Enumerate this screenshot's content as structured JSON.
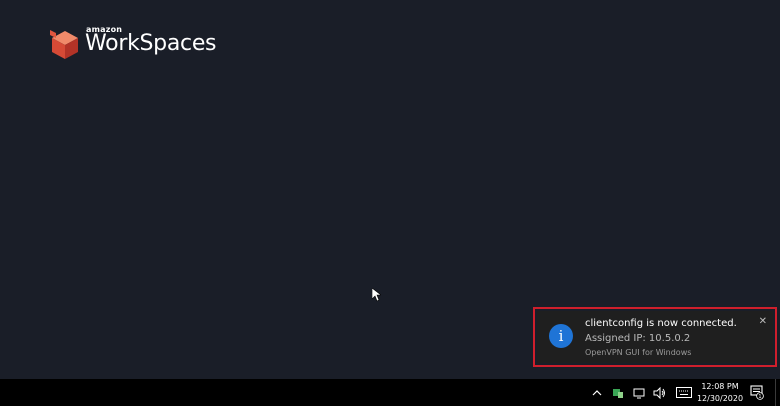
{
  "logo": {
    "small_text": "amazon",
    "main_text": "WorkSpaces",
    "icon": "cube-logo"
  },
  "notification": {
    "icon": "info-icon",
    "icon_glyph": "i",
    "title": "clientconfig is now connected.",
    "body": "Assigned IP: 10.5.0.2",
    "source": "OpenVPN GUI for Windows",
    "close_glyph": "✕",
    "highlight_color": "#cf1f2c",
    "accent_color": "#1f74d6"
  },
  "taskbar": {
    "tray_icons": [
      "chevron-up-icon",
      "network-shield-icon",
      "network-icon",
      "volume-icon",
      "keyboard-icon"
    ],
    "time": "12:08 PM",
    "date": "12/30/2020",
    "notification_count": "1"
  }
}
